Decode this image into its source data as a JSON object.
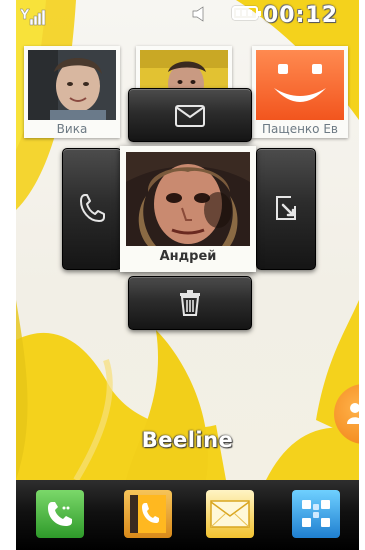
{
  "status_bar": {
    "time": "00:12",
    "signal_icon": "signal-bars-icon",
    "sound_icon": "speaker-icon",
    "battery_icon": "battery-icon"
  },
  "contacts": [
    {
      "name": "Вика",
      "icon": "contact-photo"
    },
    {
      "name": "",
      "icon": "contact-photo"
    },
    {
      "name": "Пащенко Ев",
      "icon": "smiley-avatar"
    }
  ],
  "selected_contact": {
    "name": "Андрей"
  },
  "actions": {
    "message_icon": "envelope-icon",
    "call_icon": "phone-icon",
    "edit_icon": "edit-icon",
    "delete_icon": "trash-icon"
  },
  "operator": "Beeline",
  "dock": [
    {
      "icon": "dialer-icon",
      "color": "#3fae3a"
    },
    {
      "icon": "phonebook-icon",
      "color": "#e8a62b"
    },
    {
      "icon": "messages-icon",
      "color": "#f2c230"
    },
    {
      "icon": "menu-icon",
      "color": "#2f8fd6"
    }
  ]
}
